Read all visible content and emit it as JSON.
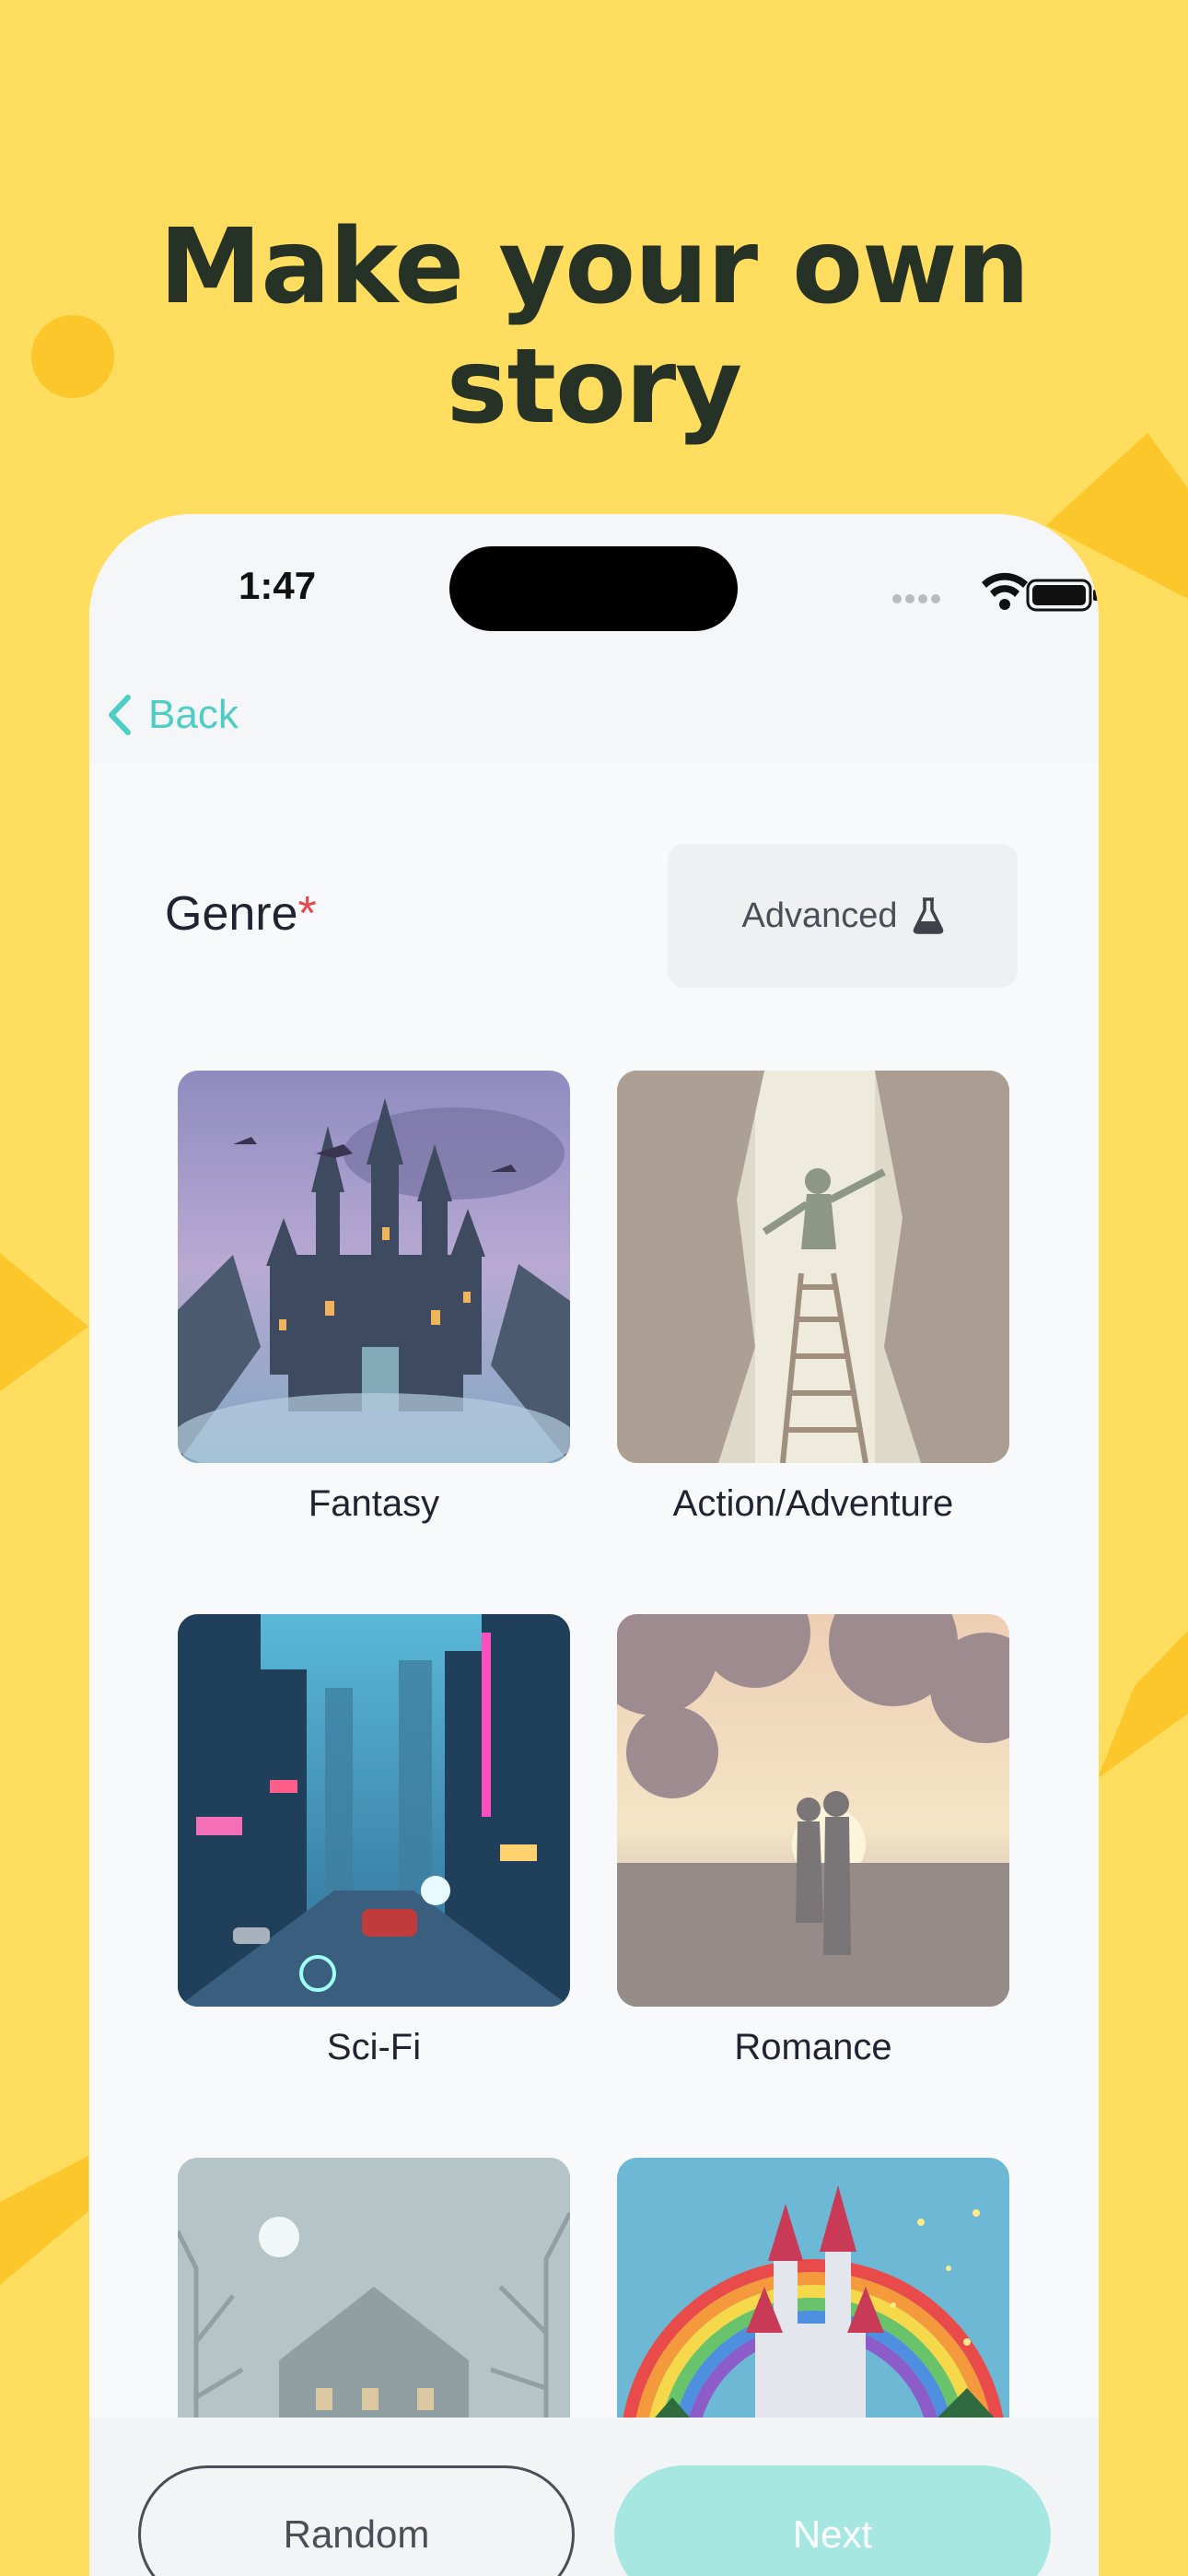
{
  "headline": "Make your own story",
  "status_bar": {
    "time": "1:47"
  },
  "nav": {
    "back_label": "Back"
  },
  "genre": {
    "label": "Genre",
    "required_mark": "*",
    "advanced_label": "Advanced"
  },
  "genres": [
    {
      "label": "Fantasy",
      "scene": "castle-with-dragons"
    },
    {
      "label": "Action/Adventure",
      "scene": "canyon-ladder-climber"
    },
    {
      "label": "Sci-Fi",
      "scene": "neon-city-street"
    },
    {
      "label": "Romance",
      "scene": "couple-under-blossoms"
    },
    {
      "label": "",
      "scene": "haunted-house-moon"
    },
    {
      "label": "",
      "scene": "rainbow-castle"
    }
  ],
  "footer": {
    "random_label": "Random",
    "next_label": "Next"
  },
  "colors": {
    "background": "#FEDD5F",
    "accent": "#4ECDC4",
    "next_disabled": "#A6E7E2",
    "required": "#E5484D"
  }
}
